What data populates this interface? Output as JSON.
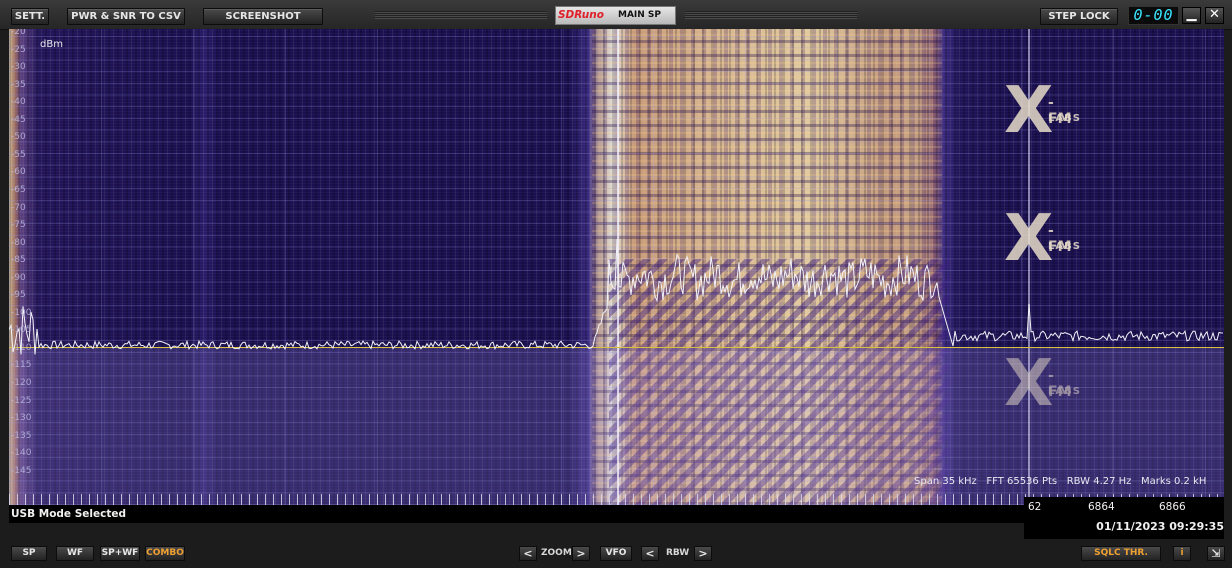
{
  "toolbar": {
    "settings": "SETT.",
    "pwr_snr_csv": "PWR & SNR TO CSV",
    "screenshot": "SCREENSHOT",
    "brand_logo": "SDRuno",
    "window_name": "MAIN SP",
    "step_lock": "STEP LOCK",
    "digit_display": "0-00",
    "minimize_icon": "minimize-icon",
    "close_icon": "close-icon"
  },
  "display": {
    "unit": "dBm",
    "y_ticks": [
      "-20",
      "-25",
      "-30",
      "-35",
      "-40",
      "-45",
      "-50",
      "-55",
      "-60",
      "-65",
      "-70",
      "-75",
      "-80",
      "-85",
      "-90",
      "-95",
      "-100",
      "-105",
      "-110",
      "-115",
      "-120",
      "-125",
      "-130",
      "-135",
      "-140",
      "-145"
    ],
    "watermark": {
      "fm": "-FM",
      "labs": "LABS"
    },
    "info": {
      "span": "Span 35 kHz",
      "fft": "FFT 65536 Pts",
      "rbw": "RBW 4.27 Hz",
      "marks": "Marks 0.2 kH"
    }
  },
  "status": {
    "mode": "USB Mode Selected"
  },
  "frequency_axis": {
    "labels": [
      "62",
      "6864",
      "6866"
    ],
    "datetime": "01/11/2023 09:29:35"
  },
  "bottombar": {
    "sp": "SP",
    "wf": "WF",
    "spwf": "SP+WF",
    "combo": "COMBO",
    "zoom_label": "ZOOM",
    "zoom_left": "<",
    "zoom_right": ">",
    "vfo": "VFO",
    "rbw_label": "RBW",
    "rbw_left": "<",
    "rbw_right": ">",
    "sqlc": "SQLC THR.",
    "info": "i",
    "resize_icon": "resize-icon"
  },
  "colors": {
    "combo_active": "#f0a030",
    "digit_display": "#38e6ff",
    "reference_line": "#d8c040"
  }
}
